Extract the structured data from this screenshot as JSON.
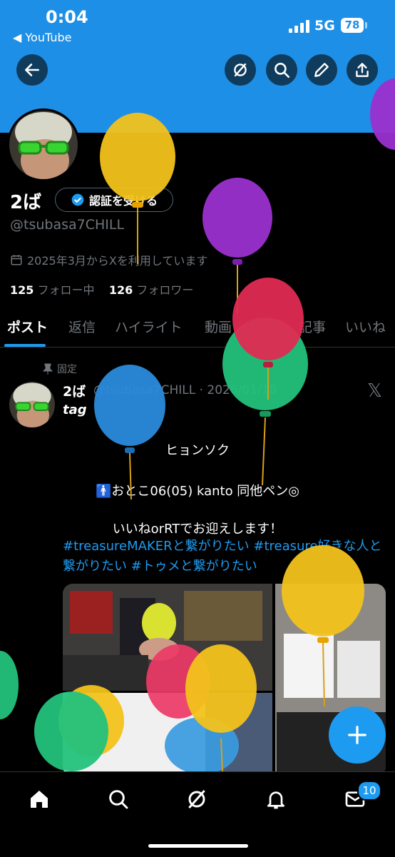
{
  "status_bar": {
    "time": "0:04",
    "back_app": "◀ YouTube",
    "network": "5G",
    "battery": "78"
  },
  "profile": {
    "display_name": "2ば",
    "verify_button": "認証を受ける",
    "handle": "@tsubasa7CHILL",
    "joined": "2025年3月からXを利用しています",
    "following_count": "125",
    "following_label": "フォロー中",
    "followers_count": "126",
    "followers_label": "フォロワー"
  },
  "tabs": [
    "ポスト",
    "返信",
    "ハイライト",
    "動画",
    "記事",
    "いいね"
  ],
  "post": {
    "pinned_label": "固定",
    "author": "2ば",
    "meta": "@tsubasa7CHILL · 2026/01/18",
    "tag": "tag",
    "line1": "ヒョンソク",
    "line2": "🚹おとこ06(05)  kanto 同他ペン◎",
    "line3": "いいねorRTでお迎えします！",
    "hashtags": "#treasureMAKERと繋がりたい  #treasure好きな人と繋がりたい  #トゥメと繋がりたい"
  },
  "fab_label": "+",
  "messages_badge": "10",
  "colors": {
    "accent": "#1d9bf0",
    "header": "#1e8fe6",
    "muted": "#71767b"
  },
  "icons": [
    "back-arrow-icon",
    "grok-icon",
    "search-icon",
    "pencil-icon",
    "share-icon",
    "home-icon",
    "bell-icon",
    "mail-icon",
    "pin-icon",
    "calendar-icon",
    "verified-icon",
    "x-logo-icon",
    "plus-icon"
  ]
}
